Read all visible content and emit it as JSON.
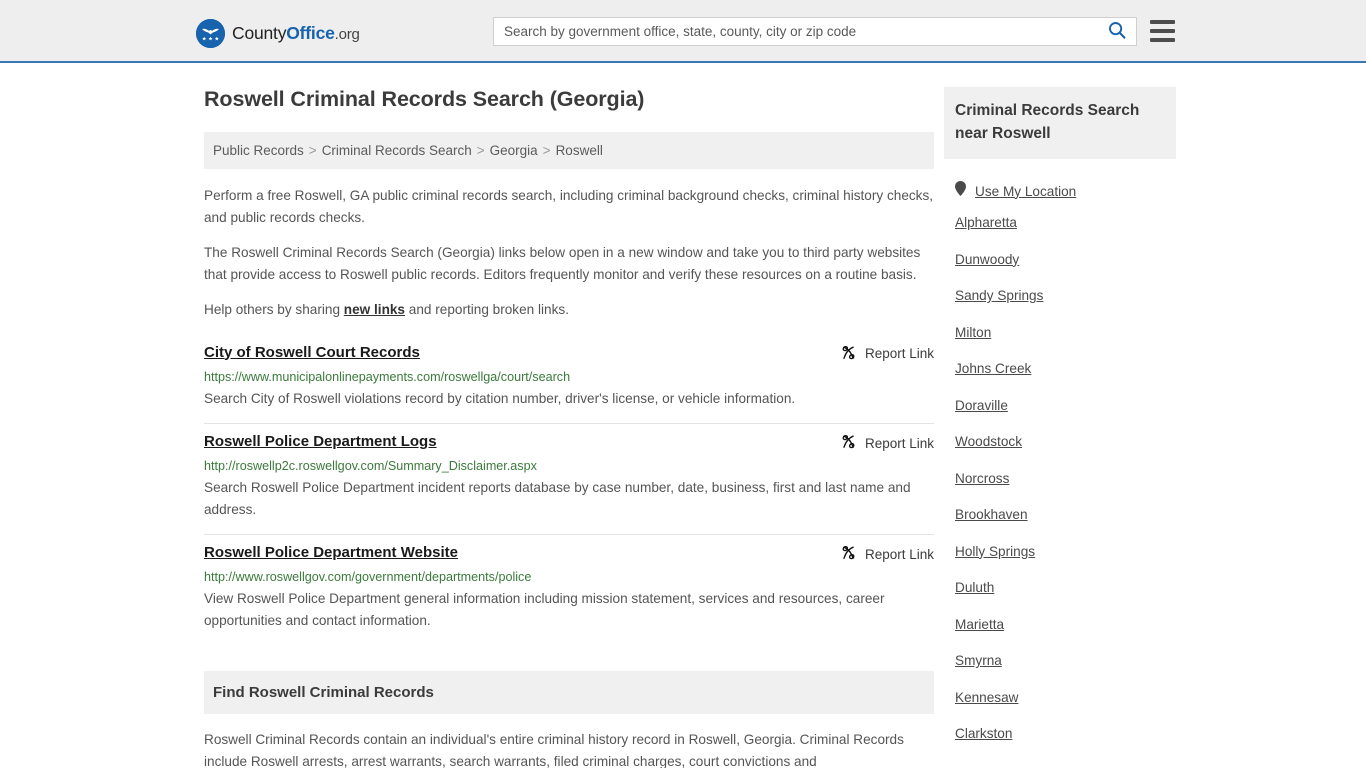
{
  "header": {
    "logo": {
      "part1": "County",
      "part2": "Office",
      "part3": ".org",
      "icon": "eagle-seal-icon"
    },
    "search": {
      "placeholder": "Search by government office, state, county, city or zip code",
      "value": "",
      "icon": "search-icon"
    },
    "menu_icon": "hamburger-menu-icon",
    "accent_color": "#3a78b5",
    "background_color": "#eeeeee"
  },
  "main": {
    "title": "Roswell Criminal Records Search (Georgia)",
    "breadcrumb": {
      "items": [
        "Public Records",
        "Criminal Records Search",
        "Georgia",
        "Roswell"
      ],
      "separator": ">"
    },
    "paragraphs": {
      "p1": "Perform a free Roswell, GA public criminal records search, including criminal background checks, criminal history checks, and public records checks.",
      "p2": "The Roswell Criminal Records Search (Georgia) links below open in a new window and take you to third party websites that provide access to Roswell public records. Editors frequently monitor and verify these resources on a routine basis.",
      "p3_before": "Help others by sharing ",
      "p3_link": "new links",
      "p3_after": " and reporting broken links."
    },
    "report_link_label": "Report Link",
    "report_link_icon": "broken-link-icon",
    "links": [
      {
        "title": "City of Roswell Court Records",
        "url": "https://www.municipalonlinepayments.com/roswellga/court/search",
        "description": "Search City of Roswell violations record by citation number, driver's license, or vehicle information."
      },
      {
        "title": "Roswell Police Department Logs",
        "url": "http://roswellp2c.roswellgov.com/Summary_Disclaimer.aspx",
        "description": "Search Roswell Police Department incident reports database by case number, date, business, first and last name and address."
      },
      {
        "title": "Roswell Police Department Website",
        "url": "http://www.roswellgov.com/government/departments/police",
        "description": "View Roswell Police Department general information including mission statement, services and resources, career opportunities and contact information."
      }
    ],
    "find_section": {
      "heading": "Find Roswell Criminal Records",
      "body": "Roswell Criminal Records contain an individual's entire criminal history record in Roswell, Georgia. Criminal Records include Roswell arrests, arrest warrants, search warrants, filed criminal charges, court convictions and"
    }
  },
  "sidebar": {
    "heading": "Criminal Records Search near Roswell",
    "use_location": {
      "label": "Use My Location",
      "icon": "map-pin-icon"
    },
    "cities": [
      "Alpharetta",
      "Dunwoody",
      "Sandy Springs",
      "Milton",
      "Johns Creek",
      "Doraville",
      "Woodstock",
      "Norcross",
      "Brookhaven",
      "Holly Springs",
      "Duluth",
      "Marietta",
      "Smyrna",
      "Kennesaw",
      "Clarkston"
    ]
  },
  "colors": {
    "link_green": "#3b7a3b",
    "panel_gray": "#f0f0f0",
    "text_gray": "#555555",
    "brand_blue": "#1763ad"
  }
}
